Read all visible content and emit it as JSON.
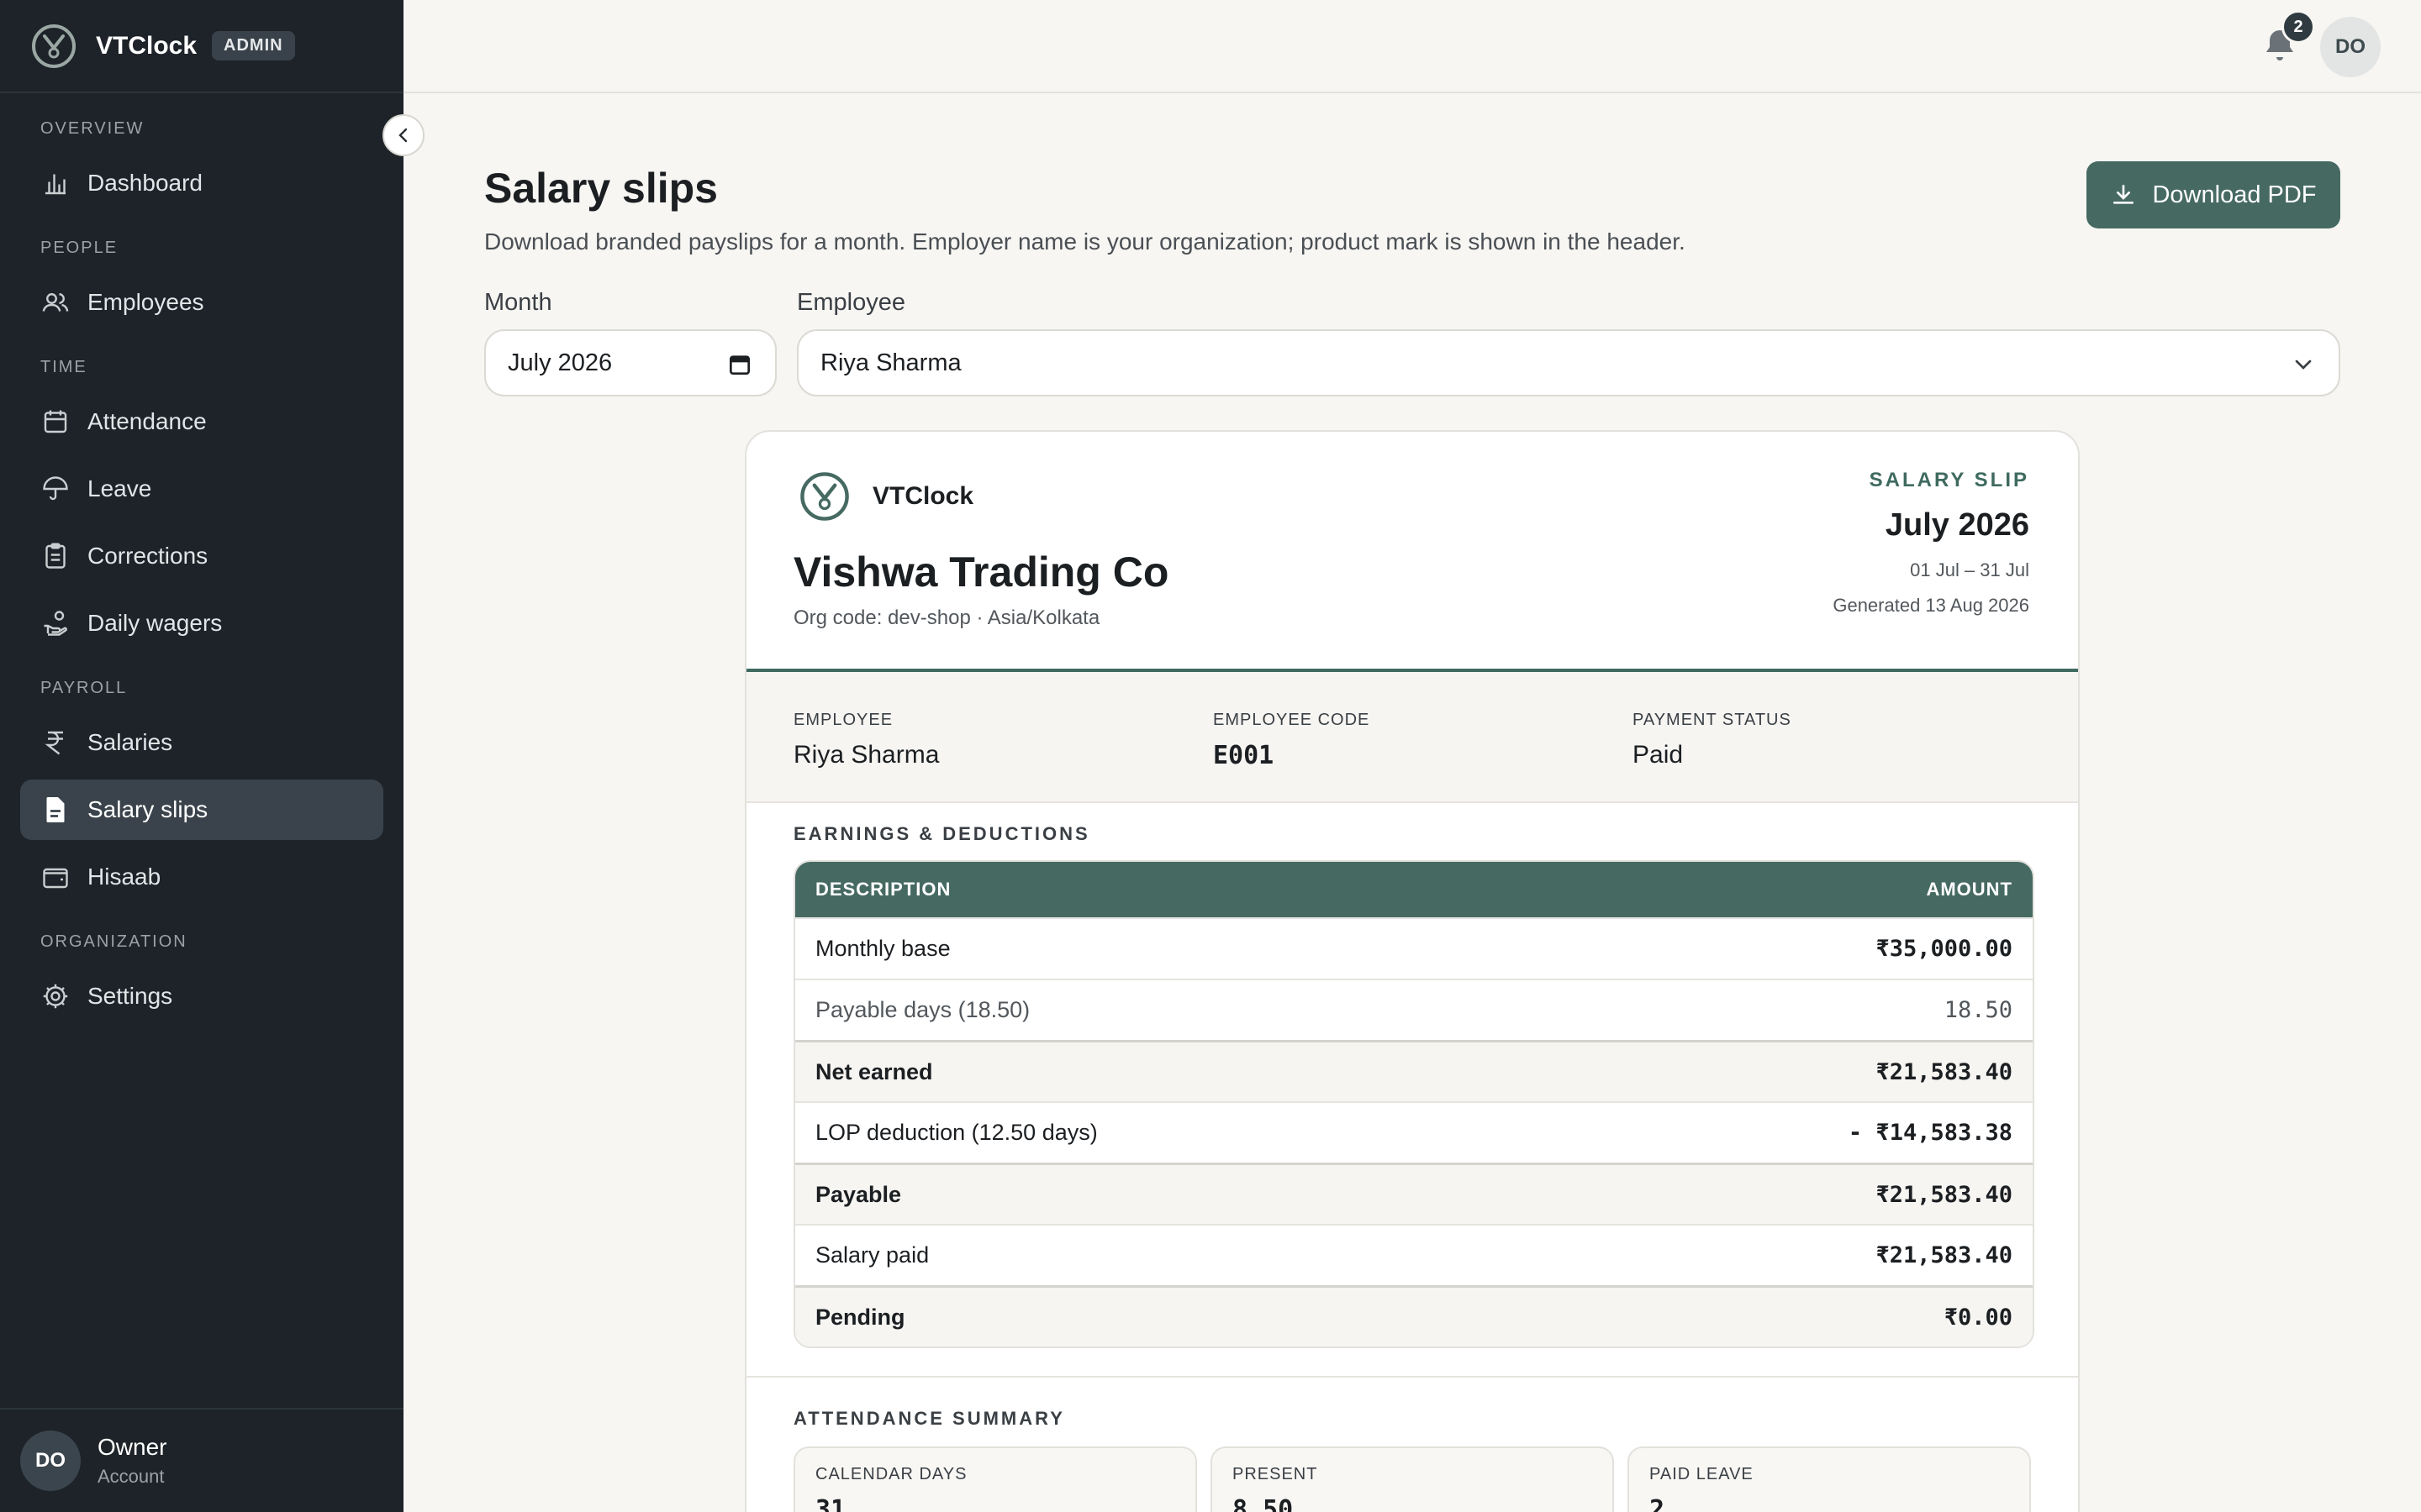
{
  "app": {
    "name": "VTClock",
    "role_badge": "ADMIN"
  },
  "sidebar": {
    "sections": [
      {
        "label": "OVERVIEW"
      },
      {
        "label": "PEOPLE"
      },
      {
        "label": "TIME"
      },
      {
        "label": "PAYROLL"
      },
      {
        "label": "ORGANIZATION"
      }
    ],
    "items": [
      {
        "label": "Dashboard",
        "icon": "bar-chart-icon"
      },
      {
        "label": "Employees",
        "icon": "users-icon"
      },
      {
        "label": "Attendance",
        "icon": "calendar-icon"
      },
      {
        "label": "Leave",
        "icon": "umbrella-icon"
      },
      {
        "label": "Corrections",
        "icon": "clipboard-icon"
      },
      {
        "label": "Daily wagers",
        "icon": "hand-coins-icon"
      },
      {
        "label": "Salaries",
        "icon": "rupee-icon"
      },
      {
        "label": "Salary slips",
        "icon": "document-icon",
        "active": true
      },
      {
        "label": "Hisaab",
        "icon": "wallet-icon"
      },
      {
        "label": "Settings",
        "icon": "gear-icon"
      }
    ],
    "user": {
      "initials": "DO",
      "name": "Owner",
      "sub": "Account"
    }
  },
  "topbar": {
    "notification_count": "2",
    "avatar_initials": "DO"
  },
  "page": {
    "title": "Salary slips",
    "subtitle": "Download branded payslips for a month. Employer name is your organization; product mark is shown in the header.",
    "download_label": "Download PDF",
    "month_label": "Month",
    "month_value": "July 2026",
    "employee_label": "Employee",
    "employee_value": "Riya Sharma"
  },
  "slip": {
    "brand": "VTClock",
    "org_name": "Vishwa Trading Co",
    "org_code": "Org code: dev-shop · Asia/Kolkata",
    "tag": "SALARY SLIP",
    "month": "July 2026",
    "range": "01 Jul – 31 Jul",
    "generated": "Generated 13 Aug 2026",
    "info": [
      {
        "key": "EMPLOYEE",
        "value": "Riya Sharma"
      },
      {
        "key": "EMPLOYEE CODE",
        "value": "E001"
      },
      {
        "key": "PAYMENT STATUS",
        "value": "Paid"
      }
    ],
    "earnings_title": "EARNINGS & DEDUCTIONS",
    "table_headers": {
      "description": "DESCRIPTION",
      "amount": "AMOUNT"
    },
    "rows": [
      {
        "label": "Monthly base",
        "amount": "₹35,000.00",
        "kind": "normal"
      },
      {
        "label": "Payable days (18.50)",
        "amount": "18.50",
        "kind": "muted"
      },
      {
        "label": "Net earned",
        "amount": "₹21,583.40",
        "kind": "sub"
      },
      {
        "label": "LOP deduction (12.50 days)",
        "amount": "- ₹14,583.38",
        "kind": "normal"
      },
      {
        "label": "Payable",
        "amount": "₹21,583.40",
        "kind": "sub"
      },
      {
        "label": "Salary paid",
        "amount": "₹21,583.40",
        "kind": "normal"
      },
      {
        "label": "Pending",
        "amount": "₹0.00",
        "kind": "sub"
      }
    ],
    "attendance_title": "ATTENDANCE SUMMARY",
    "attendance": [
      {
        "key": "CALENDAR DAYS",
        "value": "31"
      },
      {
        "key": "PRESENT",
        "value": "8.50"
      },
      {
        "key": "PAID LEAVE",
        "value": "2"
      }
    ]
  },
  "colors": {
    "sidebar_bg": "#1d2329",
    "accent": "#466a62",
    "page_bg": "#f7f6f3"
  }
}
